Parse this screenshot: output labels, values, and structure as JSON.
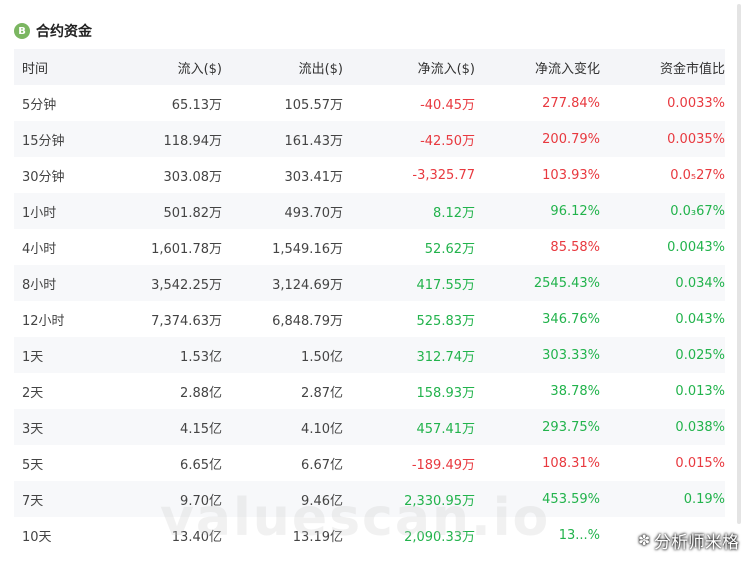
{
  "header": {
    "coin_symbol": "B",
    "title": "合约资金"
  },
  "table": {
    "columns": [
      "时间",
      "流入($)",
      "流出($)",
      "净流入($)",
      "净流入变化",
      "资金市值比"
    ],
    "rows": [
      {
        "period": "5分钟",
        "inflow": "65.13万",
        "outflow": "105.57万",
        "net": "-40.45万",
        "change": "277.84%",
        "ratio": "0.0033%",
        "net_color": "red",
        "change_color": "red",
        "ratio_color": "red"
      },
      {
        "period": "15分钟",
        "inflow": "118.94万",
        "outflow": "161.43万",
        "net": "-42.50万",
        "change": "200.79%",
        "ratio": "0.0035%",
        "net_color": "red",
        "change_color": "red",
        "ratio_color": "red"
      },
      {
        "period": "30分钟",
        "inflow": "303.08万",
        "outflow": "303.41万",
        "net": "-3,325.77",
        "change": "103.93%",
        "ratio": "0.0₅27%",
        "net_color": "red",
        "change_color": "red",
        "ratio_color": "red"
      },
      {
        "period": "1小时",
        "inflow": "501.82万",
        "outflow": "493.70万",
        "net": "8.12万",
        "change": "96.12%",
        "ratio": "0.0₃67%",
        "net_color": "green",
        "change_color": "green",
        "ratio_color": "green"
      },
      {
        "period": "4小时",
        "inflow": "1,601.78万",
        "outflow": "1,549.16万",
        "net": "52.62万",
        "change": "85.58%",
        "ratio": "0.0043%",
        "net_color": "green",
        "change_color": "red",
        "ratio_color": "green"
      },
      {
        "period": "8小时",
        "inflow": "3,542.25万",
        "outflow": "3,124.69万",
        "net": "417.55万",
        "change": "2545.43%",
        "ratio": "0.034%",
        "net_color": "green",
        "change_color": "green",
        "ratio_color": "green"
      },
      {
        "period": "12小时",
        "inflow": "7,374.63万",
        "outflow": "6,848.79万",
        "net": "525.83万",
        "change": "346.76%",
        "ratio": "0.043%",
        "net_color": "green",
        "change_color": "green",
        "ratio_color": "green"
      },
      {
        "period": "1天",
        "inflow": "1.53亿",
        "outflow": "1.50亿",
        "net": "312.74万",
        "change": "303.33%",
        "ratio": "0.025%",
        "net_color": "green",
        "change_color": "green",
        "ratio_color": "green"
      },
      {
        "period": "2天",
        "inflow": "2.88亿",
        "outflow": "2.87亿",
        "net": "158.93万",
        "change": "38.78%",
        "ratio": "0.013%",
        "net_color": "green",
        "change_color": "green",
        "ratio_color": "green"
      },
      {
        "period": "3天",
        "inflow": "4.15亿",
        "outflow": "4.10亿",
        "net": "457.41万",
        "change": "293.75%",
        "ratio": "0.038%",
        "net_color": "green",
        "change_color": "green",
        "ratio_color": "green"
      },
      {
        "period": "5天",
        "inflow": "6.65亿",
        "outflow": "6.67亿",
        "net": "-189.49万",
        "change": "108.31%",
        "ratio": "0.015%",
        "net_color": "red",
        "change_color": "red",
        "ratio_color": "red"
      },
      {
        "period": "7天",
        "inflow": "9.70亿",
        "outflow": "9.46亿",
        "net": "2,330.95万",
        "change": "453.59%",
        "ratio": "0.19%",
        "net_color": "green",
        "change_color": "green",
        "ratio_color": "green"
      },
      {
        "period": "10天",
        "inflow": "13.40亿",
        "outflow": "13.19亿",
        "net": "2,090.33万",
        "change": "13...%",
        "ratio": "",
        "net_color": "green",
        "change_color": "green",
        "ratio_color": "green"
      }
    ]
  },
  "watermark": "valuescan.io",
  "source_label": "分析师米格",
  "colors": {
    "red": "#e8393f",
    "green": "#22b34c",
    "coin": "#7bb661"
  }
}
